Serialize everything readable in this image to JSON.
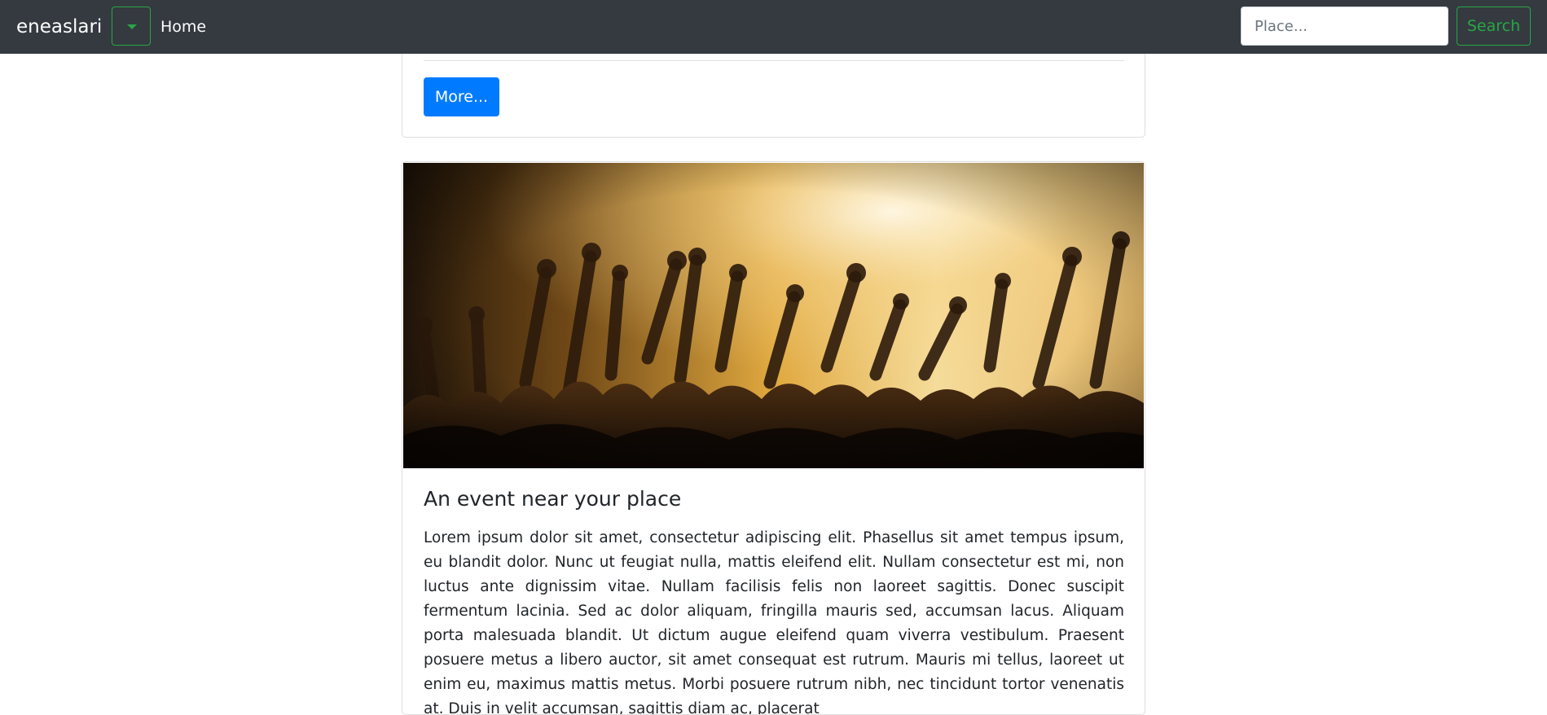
{
  "navbar": {
    "brand": "eneaslari",
    "home_label": "Home",
    "search_placeholder": "Place...",
    "search_button": "Search",
    "colors": {
      "background": "#343a40",
      "accent": "#28a745"
    }
  },
  "previous_card": {
    "more_button": "More..."
  },
  "event_card": {
    "image_description": "concert crowd with raised hands",
    "title": "An event near your place",
    "body": "Lorem ipsum dolor sit amet, consectetur adipiscing elit. Phasellus sit amet tempus ipsum, eu blandit dolor. Nunc ut feugiat nulla, mattis eleifend elit. Nullam consectetur est mi, non luctus ante dignissim vitae. Nullam facilisis felis non laoreet sagittis. Donec suscipit fermentum lacinia. Sed ac dolor aliquam, fringilla mauris sed, accumsan lacus. Aliquam porta malesuada blandit. Ut dictum augue eleifend quam viverra vestibulum. Praesent posuere metus a libero auctor, sit amet consequat est rutrum. Mauris mi tellus, laoreet ut enim eu, maximus mattis metus. Morbi posuere rutrum nibh, nec tincidunt tortor venenatis at. Duis in velit accumsan, sagittis diam ac, placerat",
    "colors": {
      "button": "#007bff"
    }
  }
}
